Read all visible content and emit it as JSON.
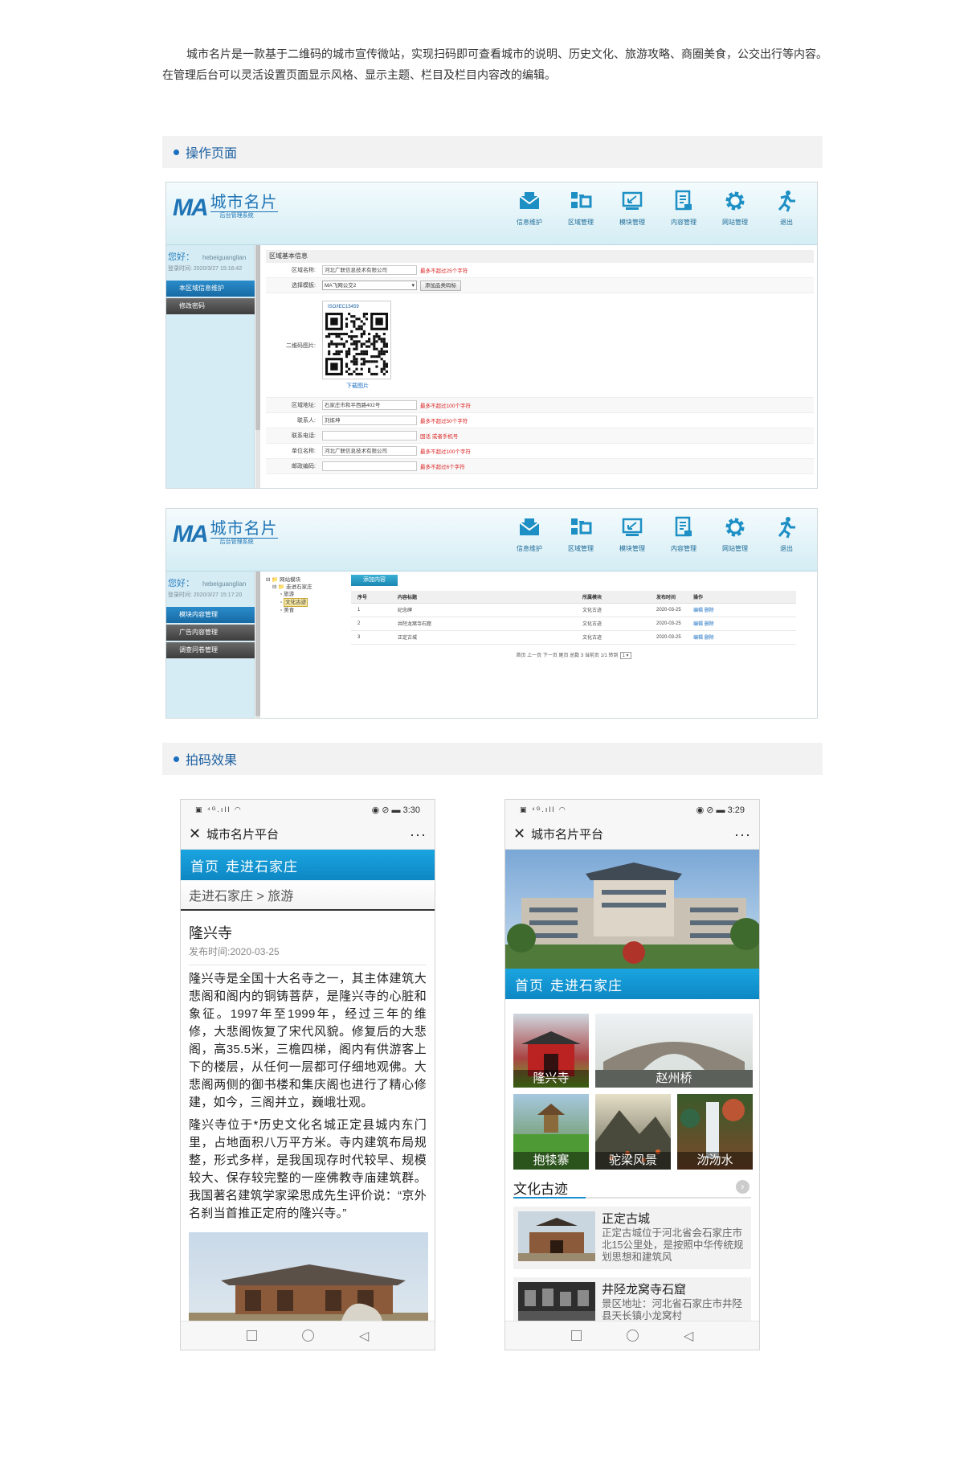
{
  "intro": {
    "p1": "城市名片是一款基于二维码的城市宣传微站，实现扫码即可查看城市的说明、历史文化、旅游攻略、商圈美食，公交出行等内容。",
    "p2": "在管理后台可以灵活设置页面显示风格、显示主题、栏目及栏目内容改的编辑。"
  },
  "section1": {
    "title": "操作页面"
  },
  "section2": {
    "title": "拍码效果"
  },
  "admin": {
    "logo_ma": "MA",
    "logo_title": "城市名片",
    "logo_sub": "后台管理系统",
    "menu": [
      {
        "label": "信息维护",
        "icon": "envelope-icon"
      },
      {
        "label": "区域管理",
        "icon": "region-icon"
      },
      {
        "label": "模块管理",
        "icon": "module-icon"
      },
      {
        "label": "内容管理",
        "icon": "document-icon"
      },
      {
        "label": "网站管理",
        "icon": "gear-icon"
      },
      {
        "label": "退出",
        "icon": "logout-icon"
      }
    ],
    "accent": "#1f74b5"
  },
  "admin1": {
    "hello": "您好：",
    "user": "hebeiguanglian",
    "login_time": "登录时间: 2020/3/27 15:16:42",
    "side": [
      "本区域信息维护",
      "修改密码"
    ],
    "form_title": "区域基本信息",
    "rows": {
      "name_label": "区域名称:",
      "name_value": "河北广联信息技术有限公司",
      "name_hint": "最多不超过25个字符",
      "tpl_label": "选择模板:",
      "tpl_value": "MA飞网公交2",
      "tpl_button": "添加品类码标",
      "qr_label": "二维码图片:",
      "qr_tag": "ISO/IEC15459",
      "qr_download": "下载图片",
      "addr_label": "区域地址:",
      "addr_value": "石家庄市和平西路402号",
      "addr_hint": "最多不超过100个字符",
      "contact_label": "联系人:",
      "contact_value": "刘炼坤",
      "contact_hint": "最多不超过50个字符",
      "phone_label": "联系电话:",
      "phone_value": "",
      "phone_hint": "固话 或者手机号",
      "unit_label": "单位名称:",
      "unit_value": "河北广联信息技术有限公司",
      "unit_hint": "最多不超过100个字符",
      "zip_label": "邮政编码:",
      "zip_value": "",
      "zip_hint": "最多不超过6个字符"
    }
  },
  "admin2": {
    "hello": "您好：",
    "user": "hebeiguanglian",
    "login_time": "登录时间: 2020/3/27 15:17:20",
    "side": [
      "模块内容管理",
      "广告内容管理",
      "调查问卷管理"
    ],
    "tree": [
      "网站模块",
      "走进石家庄",
      "旅游",
      "文化古迹",
      "美食"
    ],
    "add_button": "添加内容",
    "columns": [
      "序号",
      "内容标题",
      "所属模块",
      "发布时间",
      "操作"
    ],
    "rows": [
      [
        "1",
        "纪念碑",
        "文化古迹",
        "2020-03-25"
      ],
      [
        "2",
        "井陉龙窝寺石窟",
        "文化古迹",
        "2020-03-25"
      ],
      [
        "3",
        "正定古城",
        "文化古迹",
        "2020-03-25"
      ]
    ],
    "op_edit": "编辑",
    "op_delete": "删除",
    "pager": "首页  上一页  下一页  尾页  总数 3  当前页 1/1  转到",
    "pager_page": "1 ▾"
  },
  "phone1": {
    "time": "3:30",
    "title": "城市名片平台",
    "nav": [
      "首页",
      "走进石家庄"
    ],
    "crumb": "走进石家庄 > 旅游",
    "article_title": "隆兴寺",
    "date": "发布时间:2020-03-25",
    "para1": "隆兴寺是全国十大名寺之一，其主体建筑大悲阁和阁内的铜铸菩萨，是隆兴寺的心脏和象征。1997年至1999年，经过三年的维修，大悲阁恢复了宋代风貌。修复后的大悲阁，高35.5米，三檐四梯，阁内有供游客上下的楼层，从任何一层都可仔细地观佛。大悲阁两侧的御书楼和集庆阁也进行了精心修建，如今，三阁并立，巍峨壮观。",
    "para2": "隆兴寺位于*历史文化名城正定县城内东门里，占地面积八万平方米。寺内建筑布局规整，形式多样，是我国现存时代较早、规模较大、保存较完整的一座佛教寺庙建筑群。我国著名建筑学家梁思成先生评价说：“京外名刹当首推正定府的隆兴寺。”"
  },
  "phone2": {
    "time": "3:29",
    "title": "城市名片平台",
    "nav": [
      "首页",
      "走进石家庄"
    ],
    "tiles": [
      "隆兴寺",
      "赵州桥",
      "抱犊寨",
      "驼梁风景",
      "沕沕水"
    ],
    "section": "文化古迹",
    "cards": [
      {
        "title": "正定古城",
        "desc": "正定古城位于河北省会石家庄市北15公里处，是按照中华传统规划思想和建筑风"
      },
      {
        "title": "井陉龙窝寺石窟",
        "desc": "景区地址：河北省石家庄市井陉县天长镇小龙窝村"
      }
    ]
  }
}
